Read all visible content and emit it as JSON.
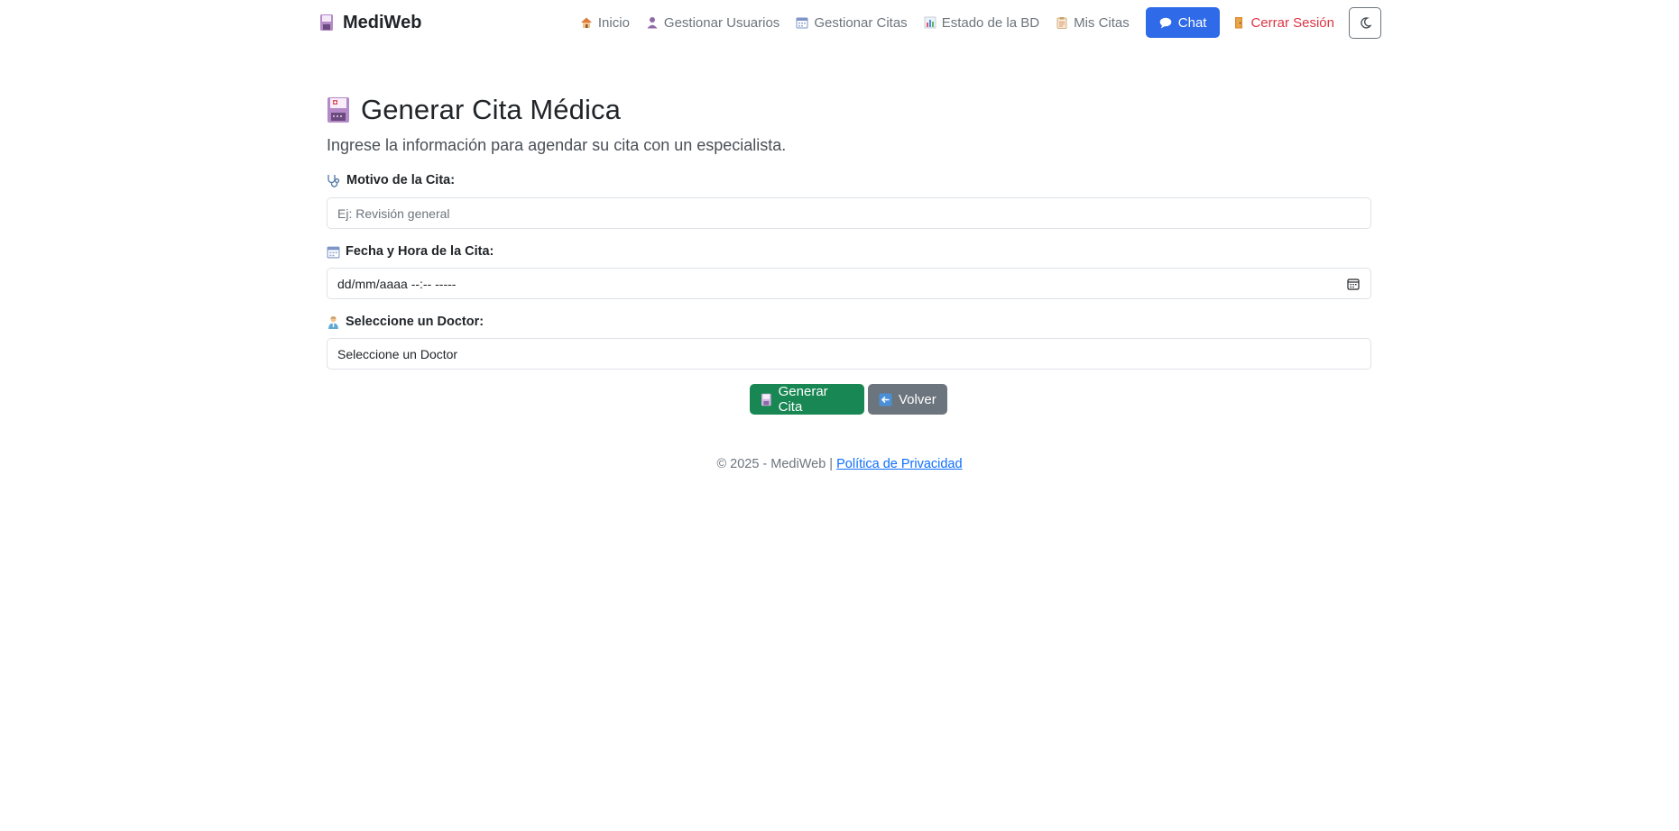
{
  "brand": {
    "name": "MediWeb",
    "icon": "floppy-disk-icon"
  },
  "nav": {
    "links": [
      {
        "label": "Inicio",
        "icon": "house-icon"
      },
      {
        "label": "Gestionar Usuarios",
        "icon": "user-icon"
      },
      {
        "label": "Gestionar Citas",
        "icon": "calendar-icon"
      },
      {
        "label": "Estado de la BD",
        "icon": "bar-chart-icon"
      },
      {
        "label": "Mis Citas",
        "icon": "clipboard-icon"
      }
    ],
    "chat_label": "Chat",
    "logout_label": "Cerrar Sesión",
    "theme_icon": "moon-icon"
  },
  "form": {
    "title": "Generar Cita Médica",
    "subtitle": "Ingrese la información para agendar su cita con un especialista.",
    "motivo": {
      "label": "Motivo de la Cita:",
      "placeholder": "Ej: Revisión general"
    },
    "fecha": {
      "label": "Fecha y Hora de la Cita:",
      "placeholder": "dd/mm/aaaa --:-- -----"
    },
    "doctor": {
      "label": "Seleccione un Doctor:",
      "selected": "Seleccione un Doctor"
    },
    "submit_label": "Generar Cita",
    "back_label": "Volver"
  },
  "footer": {
    "text": "© 2025 - MediWeb |",
    "link": "Política de Privacidad"
  },
  "colors": {
    "chat": "#2f6ae8",
    "success": "#198754",
    "secondary": "#6c757d",
    "danger": "#dc3545",
    "link": "#0d6efd"
  }
}
